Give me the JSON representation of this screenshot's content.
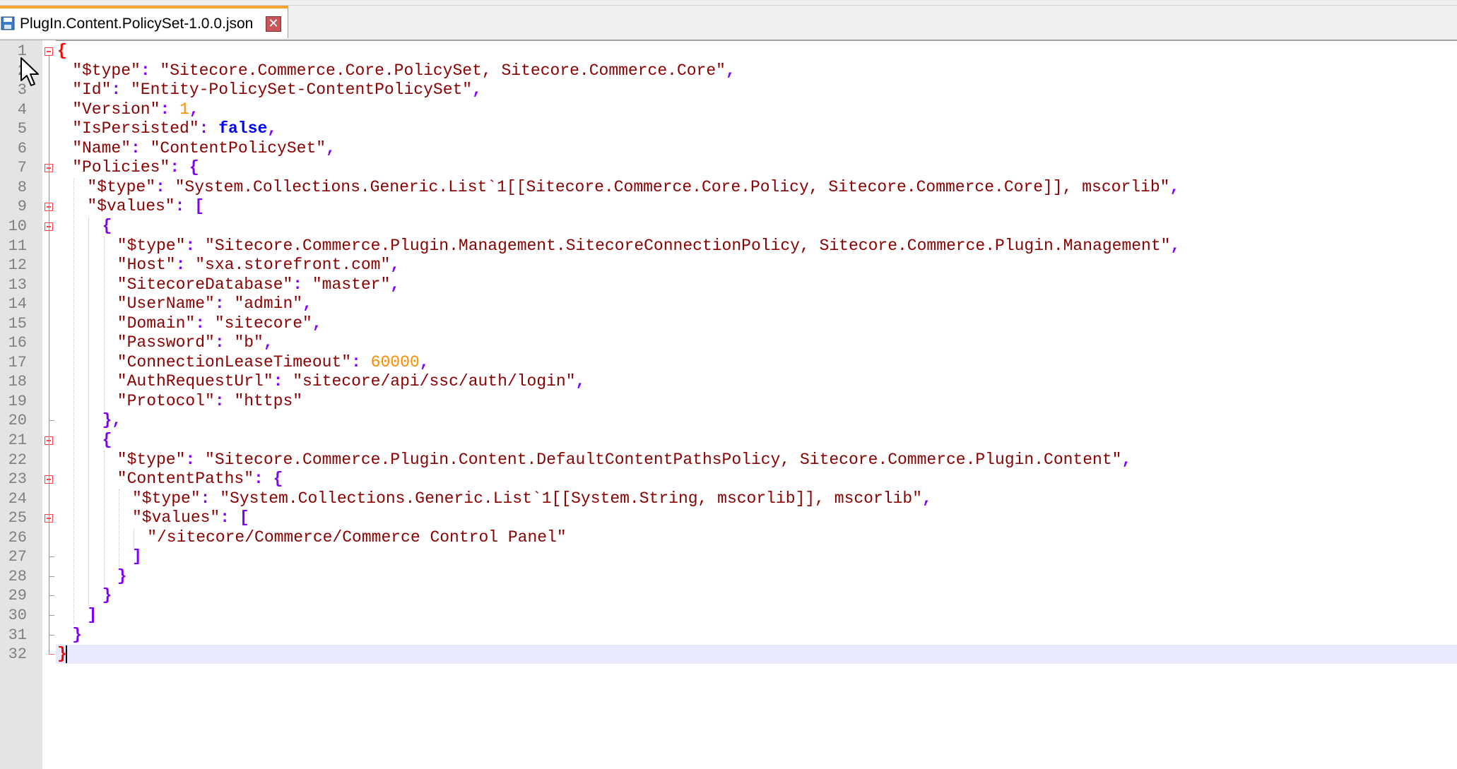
{
  "tab": {
    "title": "PlugIn.Content.PolicySet-1.0.0.json",
    "close_glyph": "✕",
    "save_icon": "floppy-disk-icon",
    "accent_color": "#f7a233"
  },
  "editor": {
    "current_line": 32,
    "colors": {
      "string": "#8b0000",
      "number": "#ff8c00",
      "keyword": "#0000ff",
      "operator": "#8000ff",
      "root_brace": "#ff0000",
      "line_number": "#808080",
      "current_line_bg": "#e8e8ff"
    },
    "lines": [
      {
        "n": "1",
        "indent": 0,
        "tokens": [
          {
            "t": "{",
            "c": "root"
          }
        ]
      },
      {
        "n": "2",
        "indent": 1,
        "tokens": [
          {
            "t": "\"$type\"",
            "c": "key"
          },
          {
            "t": ": ",
            "c": "op"
          },
          {
            "t": "\"Sitecore.Commerce.Core.PolicySet, Sitecore.Commerce.Core\"",
            "c": "str"
          },
          {
            "t": ",",
            "c": "op"
          }
        ]
      },
      {
        "n": "3",
        "indent": 1,
        "tokens": [
          {
            "t": "\"Id\"",
            "c": "key"
          },
          {
            "t": ": ",
            "c": "op"
          },
          {
            "t": "\"Entity-PolicySet-ContentPolicySet\"",
            "c": "str"
          },
          {
            "t": ",",
            "c": "op"
          }
        ]
      },
      {
        "n": "4",
        "indent": 1,
        "tokens": [
          {
            "t": "\"Version\"",
            "c": "key"
          },
          {
            "t": ": ",
            "c": "op"
          },
          {
            "t": "1",
            "c": "num"
          },
          {
            "t": ",",
            "c": "op"
          }
        ]
      },
      {
        "n": "5",
        "indent": 1,
        "tokens": [
          {
            "t": "\"IsPersisted\"",
            "c": "key"
          },
          {
            "t": ": ",
            "c": "op"
          },
          {
            "t": "false",
            "c": "kw"
          },
          {
            "t": ",",
            "c": "op"
          }
        ]
      },
      {
        "n": "6",
        "indent": 1,
        "tokens": [
          {
            "t": "\"Name\"",
            "c": "key"
          },
          {
            "t": ": ",
            "c": "op"
          },
          {
            "t": "\"ContentPolicySet\"",
            "c": "str"
          },
          {
            "t": ",",
            "c": "op"
          }
        ]
      },
      {
        "n": "7",
        "indent": 1,
        "tokens": [
          {
            "t": "\"Policies\"",
            "c": "key"
          },
          {
            "t": ": {",
            "c": "op"
          }
        ]
      },
      {
        "n": "8",
        "indent": 2,
        "tokens": [
          {
            "t": "\"$type\"",
            "c": "key"
          },
          {
            "t": ": ",
            "c": "op"
          },
          {
            "t": "\"System.Collections.Generic.List`1[[Sitecore.Commerce.Core.Policy, Sitecore.Commerce.Core]], mscorlib\"",
            "c": "str"
          },
          {
            "t": ",",
            "c": "op"
          }
        ]
      },
      {
        "n": "9",
        "indent": 2,
        "tokens": [
          {
            "t": "\"$values\"",
            "c": "key"
          },
          {
            "t": ": [",
            "c": "op"
          }
        ]
      },
      {
        "n": "10",
        "indent": 3,
        "tokens": [
          {
            "t": "{",
            "c": "op"
          }
        ]
      },
      {
        "n": "11",
        "indent": 4,
        "tokens": [
          {
            "t": "\"$type\"",
            "c": "key"
          },
          {
            "t": ": ",
            "c": "op"
          },
          {
            "t": "\"Sitecore.Commerce.Plugin.Management.SitecoreConnectionPolicy, Sitecore.Commerce.Plugin.Management\"",
            "c": "str"
          },
          {
            "t": ",",
            "c": "op"
          }
        ]
      },
      {
        "n": "12",
        "indent": 4,
        "tokens": [
          {
            "t": "\"Host\"",
            "c": "key"
          },
          {
            "t": ": ",
            "c": "op"
          },
          {
            "t": "\"sxa.storefront.com\"",
            "c": "str"
          },
          {
            "t": ",",
            "c": "op"
          }
        ]
      },
      {
        "n": "13",
        "indent": 4,
        "tokens": [
          {
            "t": "\"SitecoreDatabase\"",
            "c": "key"
          },
          {
            "t": ": ",
            "c": "op"
          },
          {
            "t": "\"master\"",
            "c": "str"
          },
          {
            "t": ",",
            "c": "op"
          }
        ]
      },
      {
        "n": "14",
        "indent": 4,
        "tokens": [
          {
            "t": "\"UserName\"",
            "c": "key"
          },
          {
            "t": ": ",
            "c": "op"
          },
          {
            "t": "\"admin\"",
            "c": "str"
          },
          {
            "t": ",",
            "c": "op"
          }
        ]
      },
      {
        "n": "15",
        "indent": 4,
        "tokens": [
          {
            "t": "\"Domain\"",
            "c": "key"
          },
          {
            "t": ": ",
            "c": "op"
          },
          {
            "t": "\"sitecore\"",
            "c": "str"
          },
          {
            "t": ",",
            "c": "op"
          }
        ]
      },
      {
        "n": "16",
        "indent": 4,
        "tokens": [
          {
            "t": "\"Password\"",
            "c": "key"
          },
          {
            "t": ": ",
            "c": "op"
          },
          {
            "t": "\"b\"",
            "c": "str"
          },
          {
            "t": ",",
            "c": "op"
          }
        ]
      },
      {
        "n": "17",
        "indent": 4,
        "tokens": [
          {
            "t": "\"ConnectionLeaseTimeout\"",
            "c": "key"
          },
          {
            "t": ": ",
            "c": "op"
          },
          {
            "t": "60000",
            "c": "num"
          },
          {
            "t": ",",
            "c": "op"
          }
        ]
      },
      {
        "n": "18",
        "indent": 4,
        "tokens": [
          {
            "t": "\"AuthRequestUrl\"",
            "c": "key"
          },
          {
            "t": ": ",
            "c": "op"
          },
          {
            "t": "\"sitecore/api/ssc/auth/login\"",
            "c": "str"
          },
          {
            "t": ",",
            "c": "op"
          }
        ]
      },
      {
        "n": "19",
        "indent": 4,
        "tokens": [
          {
            "t": "\"Protocol\"",
            "c": "key"
          },
          {
            "t": ": ",
            "c": "op"
          },
          {
            "t": "\"https\"",
            "c": "str"
          }
        ]
      },
      {
        "n": "20",
        "indent": 3,
        "tokens": [
          {
            "t": "},",
            "c": "op"
          }
        ]
      },
      {
        "n": "21",
        "indent": 3,
        "tokens": [
          {
            "t": "{",
            "c": "op"
          }
        ]
      },
      {
        "n": "22",
        "indent": 4,
        "tokens": [
          {
            "t": "\"$type\"",
            "c": "key"
          },
          {
            "t": ": ",
            "c": "op"
          },
          {
            "t": "\"Sitecore.Commerce.Plugin.Content.DefaultContentPathsPolicy, Sitecore.Commerce.Plugin.Content\"",
            "c": "str"
          },
          {
            "t": ",",
            "c": "op"
          }
        ]
      },
      {
        "n": "23",
        "indent": 4,
        "tokens": [
          {
            "t": "\"ContentPaths\"",
            "c": "key"
          },
          {
            "t": ": {",
            "c": "op"
          }
        ]
      },
      {
        "n": "24",
        "indent": 5,
        "tokens": [
          {
            "t": "\"$type\"",
            "c": "key"
          },
          {
            "t": ": ",
            "c": "op"
          },
          {
            "t": "\"System.Collections.Generic.List`1[[System.String, mscorlib]], mscorlib\"",
            "c": "str"
          },
          {
            "t": ",",
            "c": "op"
          }
        ]
      },
      {
        "n": "25",
        "indent": 5,
        "tokens": [
          {
            "t": "\"$values\"",
            "c": "key"
          },
          {
            "t": ": [",
            "c": "op"
          }
        ]
      },
      {
        "n": "26",
        "indent": 6,
        "tokens": [
          {
            "t": "\"/sitecore/Commerce/Commerce Control Panel\"",
            "c": "str"
          }
        ]
      },
      {
        "n": "27",
        "indent": 5,
        "tokens": [
          {
            "t": "]",
            "c": "op"
          }
        ]
      },
      {
        "n": "28",
        "indent": 4,
        "tokens": [
          {
            "t": "}",
            "c": "op"
          }
        ]
      },
      {
        "n": "29",
        "indent": 3,
        "tokens": [
          {
            "t": "}",
            "c": "op"
          }
        ]
      },
      {
        "n": "30",
        "indent": 2,
        "tokens": [
          {
            "t": "]",
            "c": "op"
          }
        ]
      },
      {
        "n": "31",
        "indent": 1,
        "tokens": [
          {
            "t": "}",
            "c": "op"
          }
        ]
      },
      {
        "n": "32",
        "indent": 0,
        "tokens": [
          {
            "t": "}",
            "c": "root"
          }
        ]
      }
    ]
  }
}
